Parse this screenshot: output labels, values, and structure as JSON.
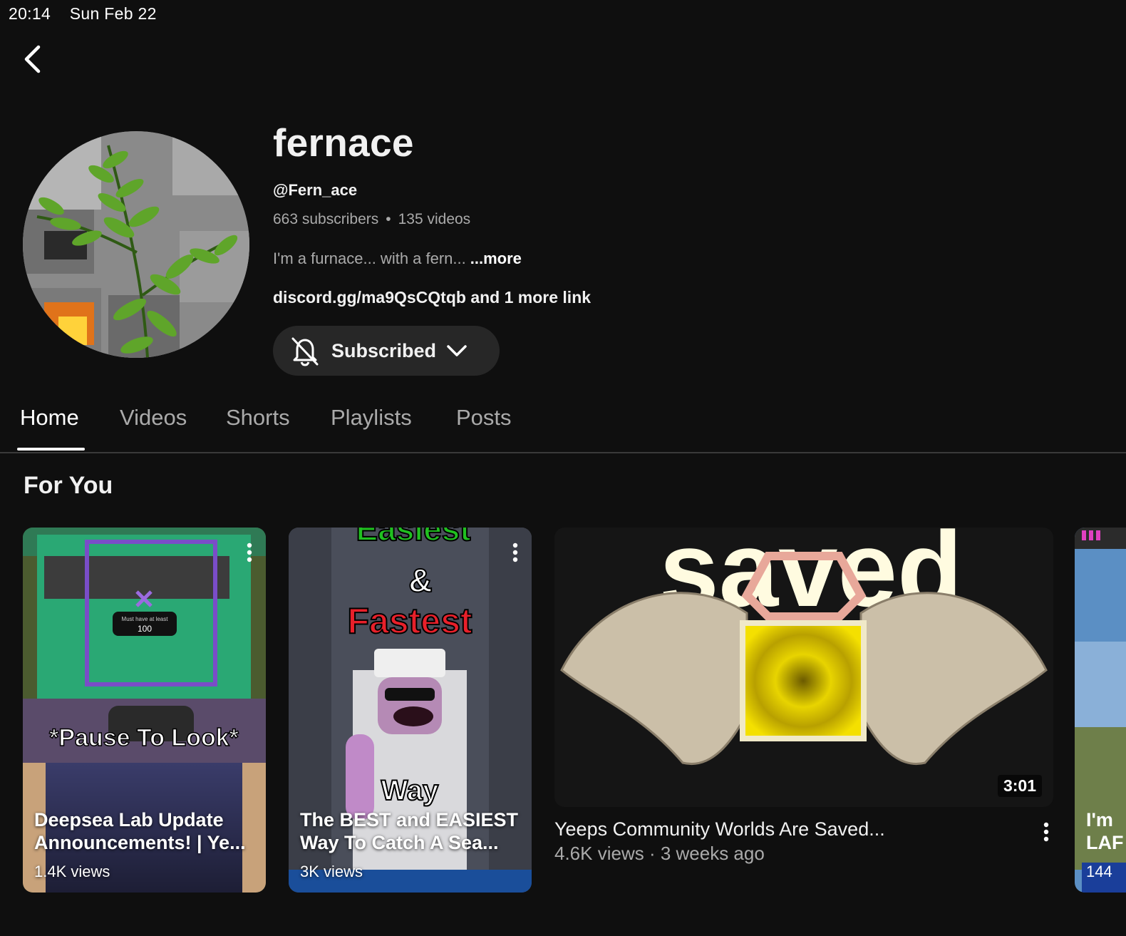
{
  "status_bar": {
    "time": "20:14",
    "date": "Sun Feb 22"
  },
  "channel": {
    "name": "fernace",
    "handle": "@Fern_ace",
    "subscribers": "663 subscribers",
    "separator": "•",
    "videos": "135 videos",
    "description": "I'm a furnace... with a fern...",
    "more_label": "...more",
    "links": "discord.gg/ma9QsCQtqb and 1 more link",
    "subscribe_label": "Subscribed"
  },
  "tabs": [
    {
      "label": "Home",
      "active": true
    },
    {
      "label": "Videos"
    },
    {
      "label": "Shorts"
    },
    {
      "label": "Playlists"
    },
    {
      "label": "Posts"
    }
  ],
  "section": {
    "title": "For You"
  },
  "items": [
    {
      "title": "Deepsea Lab Update Announcements! | Ye...",
      "views": "1.4K views",
      "overlay": "*Pause To Look*",
      "badge": "Must have at least",
      "badge_value": "100"
    },
    {
      "title": "The BEST and EASIEST Way To Catch A Sea...",
      "views": "3K views",
      "overlay_top": "Easiest",
      "overlay_amp": "&",
      "overlay_mid": "Fastest",
      "overlay_way": "Way"
    },
    {
      "title": "Yeeps Community Worlds Are Saved...",
      "meta": "4.6K views · 3 weeks ago",
      "duration": "3:01",
      "overlay": "saved"
    },
    {
      "title_line1": "I'm",
      "title_line2": "LAF",
      "views": "144"
    }
  ],
  "colors": {
    "background": "#0f0f0f",
    "button": "#272727",
    "muted_text": "#aaaaaa"
  },
  "icons": [
    "back-arrow-icon",
    "bell-off-icon",
    "chevron-down-icon",
    "more-vertical-icon"
  ]
}
